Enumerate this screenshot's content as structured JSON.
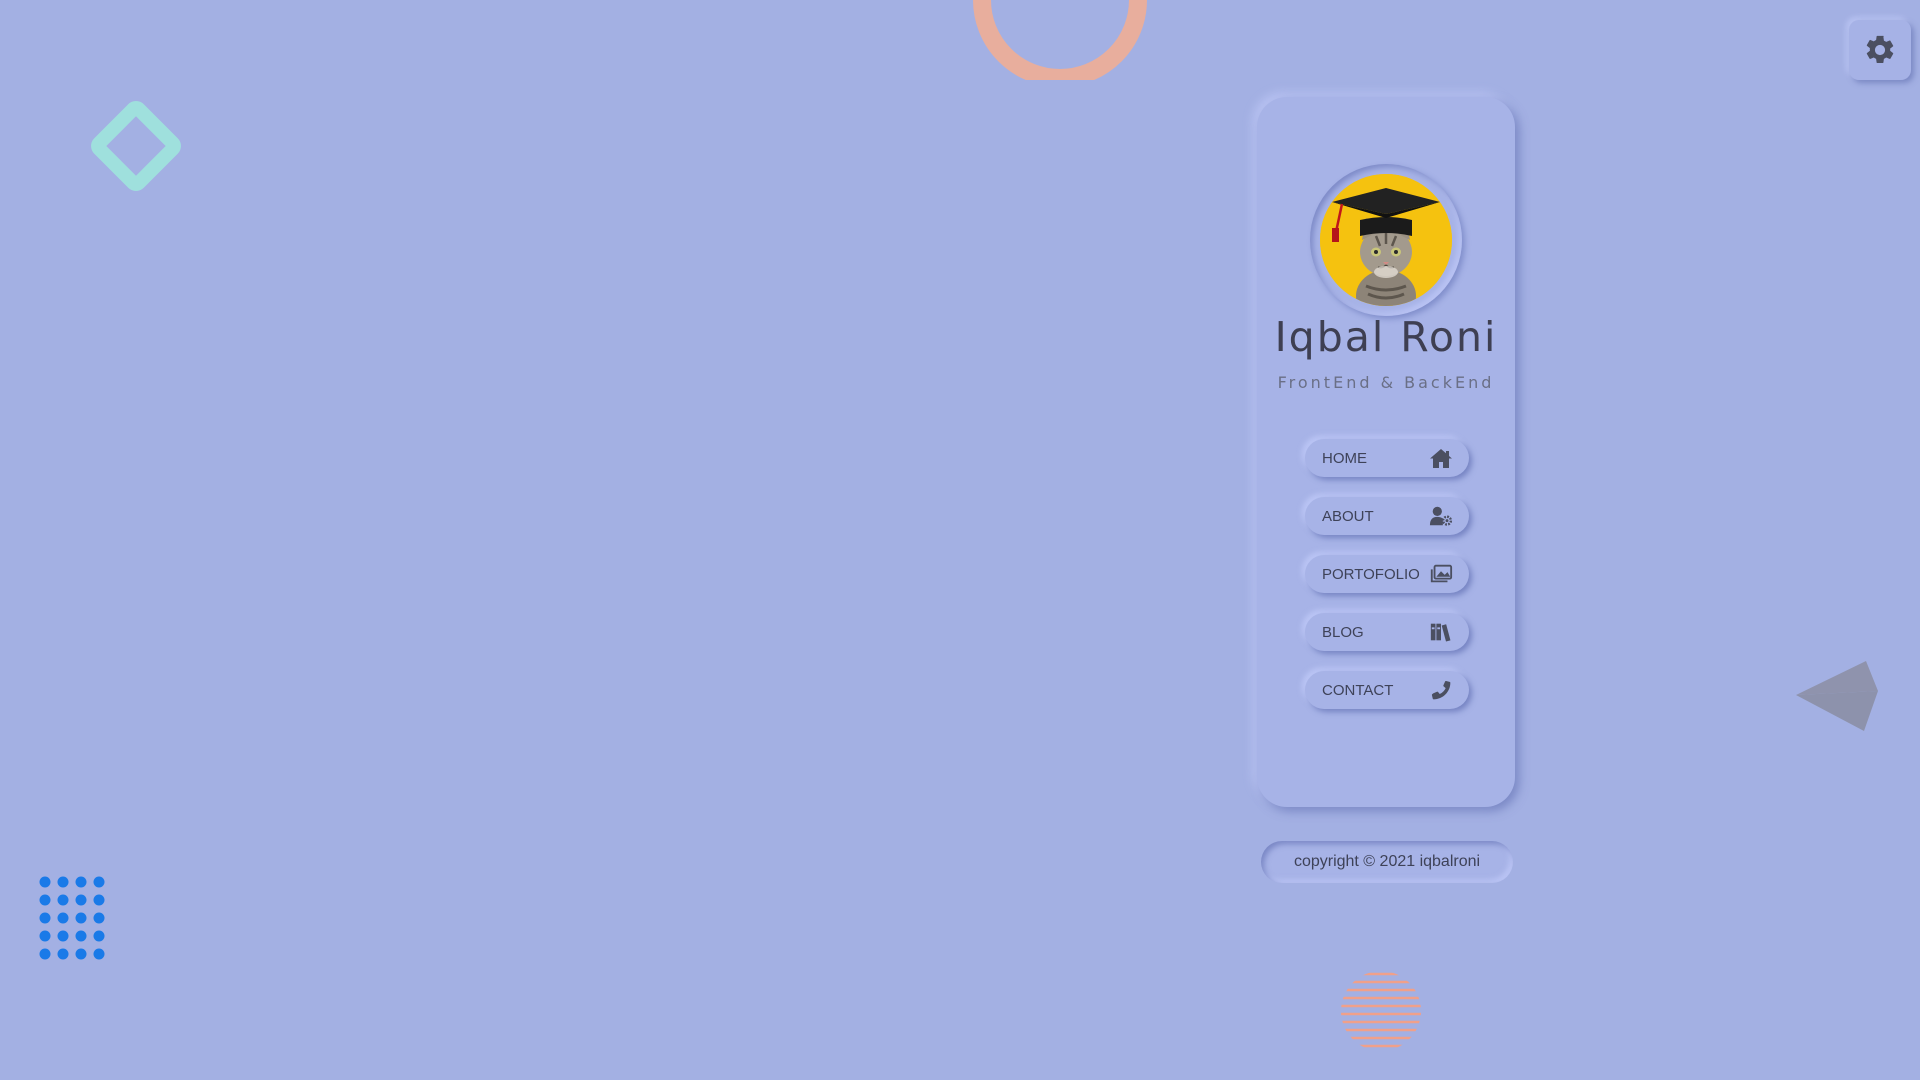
{
  "profile": {
    "name": "Iqbal Roni",
    "role": "FrontEnd & BackEnd"
  },
  "nav": {
    "items": [
      {
        "label": "HOME",
        "icon": "home-icon"
      },
      {
        "label": "ABOUT",
        "icon": "user-cog-icon"
      },
      {
        "label": "PORTOFOLIO",
        "icon": "images-icon"
      },
      {
        "label": "BLOG",
        "icon": "books-icon"
      },
      {
        "label": "CONTACT",
        "icon": "phone-icon"
      }
    ]
  },
  "footer": {
    "copyright": "copyright © 2021 iqbalroni"
  },
  "settings": {
    "icon": "gear-icon"
  },
  "colors": {
    "background": "#a3b0e3",
    "text": "#3e4258",
    "icon": "#4b4f61",
    "avatar_bg": "#f5c20f",
    "ring": "#e8ae9d",
    "diamond": "#9fe0dd",
    "dots": "#1a7ae8",
    "plane": "#8f93ad",
    "stripes": "#f0a08a"
  }
}
